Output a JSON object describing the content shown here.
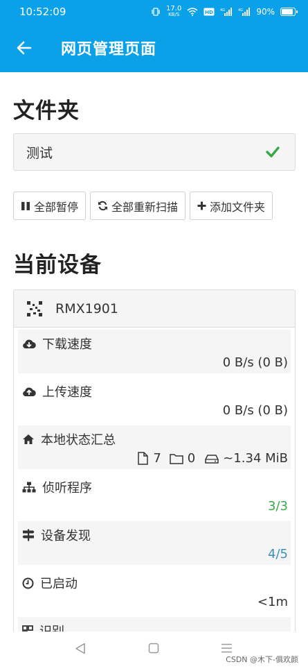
{
  "status_bar": {
    "time": "10:52:09",
    "net_speed_value": "17.0",
    "net_speed_unit": "KB/S",
    "battery_pct": "90%"
  },
  "app_bar": {
    "title": "网页管理页面"
  },
  "folders": {
    "heading": "文件夹",
    "items": [
      {
        "name": "测试"
      }
    ]
  },
  "actions": {
    "pause_all": "全部暂停",
    "rescan_all": "全部重新扫描",
    "add_folder": "添加文件夹"
  },
  "device": {
    "heading": "当前设备",
    "name": "RMX1901",
    "stats": [
      {
        "label": "下载速度",
        "value": "0 B/s (0 B)"
      },
      {
        "label": "上传速度",
        "value": "0 B/s (0 B)"
      },
      {
        "label": "本地状态汇总",
        "files": "7",
        "folders": "0",
        "size": "~1.34 MiB"
      },
      {
        "label": "侦听程序",
        "value": "3/3"
      },
      {
        "label": "设备发现",
        "value": "4/5"
      },
      {
        "label": "已启动",
        "value": "<1m"
      },
      {
        "label": "识别"
      }
    ]
  },
  "watermark": "CSDN @木下-俱欢颜",
  "colors": {
    "primary": "#0ba1e8",
    "check": "#3aa845",
    "green_value": "#3aa845",
    "blue_value": "#3c8dbc"
  }
}
